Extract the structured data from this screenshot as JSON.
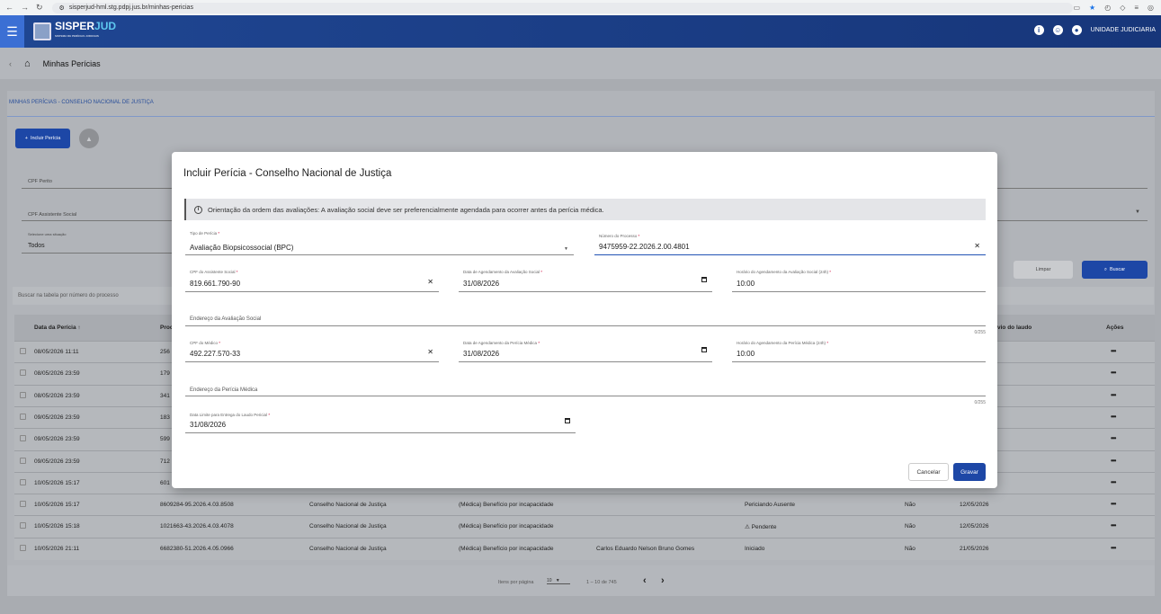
{
  "browser": {
    "url": "sisperjud-hml.stg.pdpj.jus.br/minhas-pericias"
  },
  "app": {
    "logo_main": "SISPER",
    "logo_accent": "JUD",
    "logo_sub": "SISTEMA DE PERÍCIAS JUDICIAIS",
    "unit_label": "UNIDADE JUDICIARIA"
  },
  "breadcrumb": {
    "title": "Minhas Perícias"
  },
  "section": {
    "title": "MINHAS PERÍCIAS - CONSELHO NACIONAL DE JUSTIÇA"
  },
  "toolbar": {
    "incluir_label": "Incluir Perícia"
  },
  "filters": {
    "cpf_perito": "CPF Perito",
    "cpf_assistente": "CPF Assistente Social",
    "situacao_label": "Selecione uma situação",
    "situacao_value": "Todos",
    "limpar": "Limpar",
    "buscar": "Buscar",
    "search_placeholder": "Buscar na tabela por número do processo"
  },
  "table": {
    "headers": {
      "data": "Data da Perícia",
      "proc": "Proc",
      "laudo": "vio do laudo",
      "acoes": "Ações"
    },
    "rows": [
      {
        "data": "08/05/2026 11:11",
        "proc": "256",
        "orgao": "",
        "tipo": "",
        "perito": "",
        "status": "",
        "sim": "",
        "prazo": ""
      },
      {
        "data": "08/05/2026 23:59",
        "proc": "179",
        "orgao": "",
        "tipo": "",
        "perito": "",
        "status": "",
        "sim": "",
        "prazo": ""
      },
      {
        "data": "08/05/2026 23:59",
        "proc": "341",
        "orgao": "",
        "tipo": "",
        "perito": "",
        "status": "",
        "sim": "",
        "prazo": ""
      },
      {
        "data": "09/05/2026 23:59",
        "proc": "183",
        "orgao": "",
        "tipo": "",
        "perito": "",
        "status": "",
        "sim": "",
        "prazo": ""
      },
      {
        "data": "09/05/2026 23:59",
        "proc": "599",
        "orgao": "",
        "tipo": "",
        "perito": "",
        "status": "",
        "sim": "",
        "prazo": ""
      },
      {
        "data": "09/05/2026 23:59",
        "proc": "712",
        "orgao": "",
        "tipo": "",
        "perito": "",
        "status": "",
        "sim": "",
        "prazo": ""
      },
      {
        "data": "10/05/2026 15:17",
        "proc": "601",
        "orgao": "",
        "tipo": "",
        "perito": "",
        "status": "",
        "sim": "",
        "prazo": ""
      },
      {
        "data": "10/05/2026 15:17",
        "proc": "8609284-95.2026.4.03.8508",
        "orgao": "Conselho Nacional de Justiça",
        "tipo": "(Médica) Benefício por incapacidade",
        "perito": "",
        "status": "Periciando Ausente",
        "sim": "Não",
        "prazo": "12/05/2026"
      },
      {
        "data": "10/05/2026 15:18",
        "proc": "1021663-43.2026.4.03.4078",
        "orgao": "Conselho Nacional de Justiça",
        "tipo": "(Médica) Benefício por incapacidade",
        "perito": "",
        "status": "⚠ Pendente",
        "sim": "Não",
        "prazo": "12/05/2026"
      },
      {
        "data": "10/05/2026 21:11",
        "proc": "6682380-51.2026.4.05.0966",
        "orgao": "Conselho Nacional de Justiça",
        "tipo": "(Médica) Benefício por incapacidade",
        "perito": "Carlos Eduardo Nelson Bruno Gomes",
        "status": "Iniciado",
        "sim": "Não",
        "prazo": "21/05/2026"
      }
    ]
  },
  "paginator": {
    "label": "Itens por página",
    "size": "10",
    "range": "1 – 10 de 745"
  },
  "modal": {
    "title": "Incluir Perícia - Conselho Nacional de Justiça",
    "info": "Orientação da ordem das avaliações: A avaliação social deve ser preferencialmente agendada para ocorrer antes da perícia médica.",
    "tipo_label": "Tipo de Perícia",
    "tipo_value": "Avaliação Biopsicossocial (BPC)",
    "processo_label": "Número do Processo",
    "processo_value": "9475959-22.2026.2.00.4801",
    "cpf_assist_label": "CPF do Assistente Social",
    "cpf_assist_value": "819.661.790-90",
    "data_social_label": "Data de Agendamento da Avaliação Social",
    "data_social_value": "31/08/2026",
    "hora_social_label": "Horário do Agendamento da Avaliação Social (24h)",
    "hora_social_value": "10:00",
    "end_social_label": "Endereço da Avaliação Social",
    "end_social_count": "0/255",
    "cpf_medico_label": "CPF do Médico",
    "cpf_medico_value": "492.227.570-33",
    "data_medica_label": "Data de Agendamento da Perícia Médica",
    "data_medica_value": "31/08/2026",
    "hora_medica_label": "Horário do Agendamento da Perícia Médica (24h)",
    "hora_medica_value": "10:00",
    "end_medica_label": "Endereço da Perícia Médica",
    "end_medica_count": "0/255",
    "limite_label": "Data Limite para Entrega do Laudo Pericial",
    "limite_value": "31/08/2026",
    "cancelar": "Cancelar",
    "gravar": "Gravar"
  }
}
